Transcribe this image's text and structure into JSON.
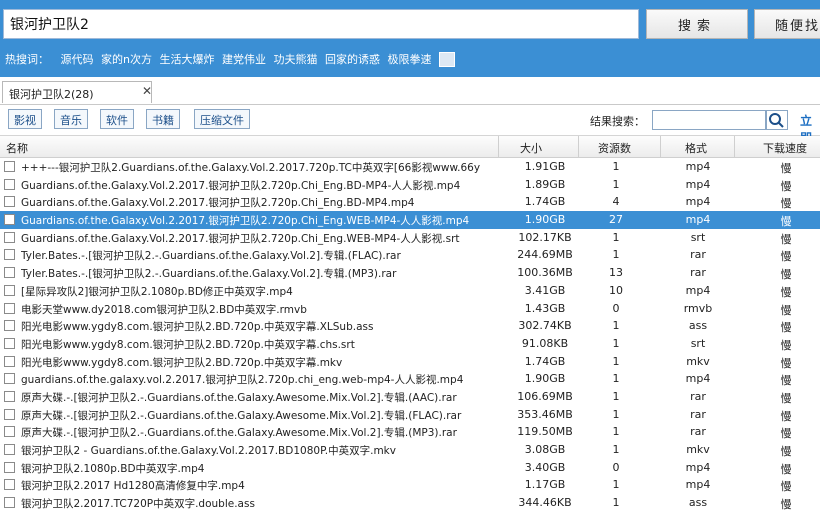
{
  "search": {
    "value": "银河护卫队2",
    "button": "搜索",
    "random_button": "随便找"
  },
  "hot": {
    "label": "热搜词：",
    "items": [
      "源代码",
      "家的n次方",
      "生活大爆炸",
      "建党伟业",
      "功夫熊猫",
      "回家的诱惑",
      "极限拳速"
    ]
  },
  "tab": {
    "label": "银河护卫队2(28)",
    "close": "✕"
  },
  "filters": [
    "影视",
    "音乐",
    "软件",
    "书籍",
    "压缩文件"
  ],
  "result_search": {
    "label": "结果搜索：",
    "value": "",
    "link": "立即"
  },
  "columns": {
    "name": "名称",
    "size": "大小",
    "count": "资源数",
    "format": "格式",
    "speed": "下载速度"
  },
  "rows": [
    {
      "name": "+++---银河护卫队2.Guardians.of.the.Galaxy.Vol.2.2017.720p.TC中英双字[66影视www.66y",
      "size": "1.91GB",
      "count": "1",
      "format": "mp4",
      "speed": "慢"
    },
    {
      "name": "Guardians.of.the.Galaxy.Vol.2.2017.银河护卫队2.720p.Chi_Eng.BD-MP4-人人影视.mp4",
      "size": "1.89GB",
      "count": "1",
      "format": "mp4",
      "speed": "慢"
    },
    {
      "name": "Guardians.of.the.Galaxy.Vol.2.2017.银河护卫队2.720p.Chi_Eng.BD-MP4.mp4",
      "size": "1.74GB",
      "count": "4",
      "format": "mp4",
      "speed": "慢"
    },
    {
      "name": "Guardians.of.the.Galaxy.Vol.2.2017.银河护卫队2.720p.Chi_Eng.WEB-MP4-人人影视.mp4",
      "size": "1.90GB",
      "count": "27",
      "format": "mp4",
      "speed": "慢",
      "selected": true
    },
    {
      "name": "Guardians.of.the.Galaxy.Vol.2.2017.银河护卫队2.720p.Chi_Eng.WEB-MP4-人人影视.srt",
      "size": "102.17KB",
      "count": "1",
      "format": "srt",
      "speed": "慢"
    },
    {
      "name": "Tyler.Bates.-.[银河护卫队2.-.Guardians.of.the.Galaxy.Vol.2].专辑.(FLAC).rar",
      "size": "244.69MB",
      "count": "1",
      "format": "rar",
      "speed": "慢"
    },
    {
      "name": "Tyler.Bates.-.[银河护卫队2.-.Guardians.of.the.Galaxy.Vol.2].专辑.(MP3).rar",
      "size": "100.36MB",
      "count": "13",
      "format": "rar",
      "speed": "慢"
    },
    {
      "name": "[星际异攻队2]银河护卫队2.1080p.BD修正中英双字.mp4",
      "size": "3.41GB",
      "count": "10",
      "format": "mp4",
      "speed": "慢"
    },
    {
      "name": "电影天堂www.dy2018.com银河护卫队2.BD中英双字.rmvb",
      "size": "1.43GB",
      "count": "0",
      "format": "rmvb",
      "speed": "慢"
    },
    {
      "name": "阳光电影www.ygdy8.com.银河护卫队2.BD.720p.中英双字幕.XLSub.ass",
      "size": "302.74KB",
      "count": "1",
      "format": "ass",
      "speed": "慢"
    },
    {
      "name": "阳光电影www.ygdy8.com.银河护卫队2.BD.720p.中英双字幕.chs.srt",
      "size": "91.08KB",
      "count": "1",
      "format": "srt",
      "speed": "慢"
    },
    {
      "name": "阳光电影www.ygdy8.com.银河护卫队2.BD.720p.中英双字幕.mkv",
      "size": "1.74GB",
      "count": "1",
      "format": "mkv",
      "speed": "慢"
    },
    {
      "name": "guardians.of.the.galaxy.vol.2.2017.银河护卫队2.720p.chi_eng.web-mp4-人人影视.mp4",
      "size": "1.90GB",
      "count": "1",
      "format": "mp4",
      "speed": "慢"
    },
    {
      "name": "原声大碟.-.[银河护卫队2.-.Guardians.of.the.Galaxy.Awesome.Mix.Vol.2].专辑.(AAC).rar",
      "size": "106.69MB",
      "count": "1",
      "format": "rar",
      "speed": "慢"
    },
    {
      "name": "原声大碟.-.[银河护卫队2.-.Guardians.of.the.Galaxy.Awesome.Mix.Vol.2].专辑.(FLAC).rar",
      "size": "353.46MB",
      "count": "1",
      "format": "rar",
      "speed": "慢"
    },
    {
      "name": "原声大碟.-.[银河护卫队2.-.Guardians.of.the.Galaxy.Awesome.Mix.Vol.2].专辑.(MP3).rar",
      "size": "119.50MB",
      "count": "1",
      "format": "rar",
      "speed": "慢"
    },
    {
      "name": "银河护卫队2 - Guardians.of.the.Galaxy.Vol.2.2017.BD1080P.中英双字.mkv",
      "size": "3.08GB",
      "count": "1",
      "format": "mkv",
      "speed": "慢"
    },
    {
      "name": "银河护卫队2.1080p.BD中英双字.mp4",
      "size": "3.40GB",
      "count": "0",
      "format": "mp4",
      "speed": "慢"
    },
    {
      "name": "银河护卫队2.2017 Hd1280高清修复中字.mp4",
      "size": "1.17GB",
      "count": "1",
      "format": "mp4",
      "speed": "慢"
    },
    {
      "name": "银河护卫队2.2017.TC720P中英双字.double.ass",
      "size": "344.46KB",
      "count": "1",
      "format": "ass",
      "speed": "慢"
    }
  ]
}
